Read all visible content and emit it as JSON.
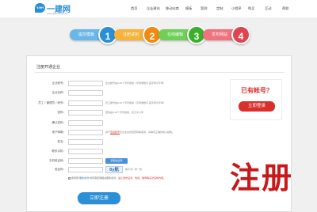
{
  "header": {
    "logo_mark": "Y.HH",
    "logo_name": "一建网",
    "logo_url": "www.yjianwang.com",
    "nav": [
      "首页",
      "企业建站",
      "移动站商",
      "模板",
      "案例",
      "定制",
      "小程序",
      "购买",
      "互动",
      "帮助"
    ]
  },
  "steps": [
    {
      "label": "提交模板",
      "number": "1",
      "bar_color": "#6ab6e8",
      "circle_color": "#2a8fd6"
    },
    {
      "label": "注册试用",
      "number": "2",
      "bar_color": "#f6b23a",
      "circle_color": "#f08a12"
    },
    {
      "label": "在线编辑",
      "number": "3",
      "bar_color": "#6fcf58",
      "circle_color": "#3daf2c"
    },
    {
      "label": "发布网站",
      "number": "4",
      "bar_color": "#f0727a",
      "circle_color": "#e04450"
    }
  ],
  "form": {
    "title": "注册开通企业",
    "fields": [
      {
        "label": "企业帐号：",
        "hint": "企业帐号由6-20个字符组成（字母或数字,首字母为字母）"
      },
      {
        "label": "企业名称：",
        "hint": ""
      },
      {
        "label": "员工 / 管理员 / 帐号：",
        "hint": "员工帐号由6-20个字符组成（字母或数字,首字母为字母）"
      },
      {
        "label": "密码：",
        "hint": "密码由6-20个字符组成，区分大小写"
      },
      {
        "label": "确认密码：",
        "hint": ""
      },
      {
        "label": "电子邮箱：",
        "hint_prefix": "用于",
        "hint_link": "激活帐号",
        "hint_suffix": "及企业在找回密码等使用，请填写正确的电子邮箱。"
      },
      {
        "label": "姓名：",
        "hint": ""
      },
      {
        "label": "联系手机：",
        "hint": ""
      },
      {
        "label": "手机验证码：",
        "hint": ""
      },
      {
        "label": "验证码：",
        "hint": ""
      }
    ],
    "code_button": "获取验证码",
    "captcha_text": "0y航",
    "captcha_hint": "看不清？换一张",
    "agree_prefix": "我同意",
    "agree_link": "\"服务条款\"",
    "agree_mid": "并同意接受相关服务条款，",
    "agree_warn": "禁止发布违法、色情、赌博等违法违规内容。",
    "submit": "立即注册"
  },
  "sidebar": {
    "question": "已有帐号？",
    "login_button": "立即登录"
  },
  "big_title": "注册"
}
